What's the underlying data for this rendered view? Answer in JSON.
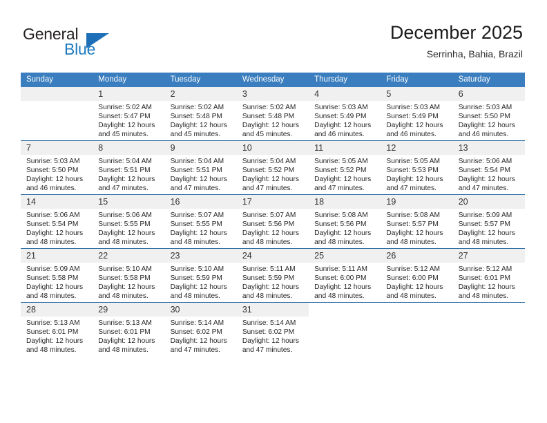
{
  "brand": {
    "name_part1": "General",
    "name_part2": "Blue",
    "triangle_color": "#1d6fb8"
  },
  "header": {
    "title": "December 2025",
    "location": "Serrinha, Bahia, Brazil"
  },
  "theme": {
    "header_blue": "#3a7ebf",
    "divider_blue": "#2e6da4",
    "daynum_band": "#f0f0f0"
  },
  "weekdays": [
    "Sunday",
    "Monday",
    "Tuesday",
    "Wednesday",
    "Thursday",
    "Friday",
    "Saturday"
  ],
  "weeks": [
    [
      {
        "day": "",
        "sunrise": "",
        "sunset": "",
        "daylight1": "",
        "daylight2": "",
        "empty": true
      },
      {
        "day": "1",
        "sunrise": "Sunrise: 5:02 AM",
        "sunset": "Sunset: 5:47 PM",
        "daylight1": "Daylight: 12 hours",
        "daylight2": "and 45 minutes."
      },
      {
        "day": "2",
        "sunrise": "Sunrise: 5:02 AM",
        "sunset": "Sunset: 5:48 PM",
        "daylight1": "Daylight: 12 hours",
        "daylight2": "and 45 minutes."
      },
      {
        "day": "3",
        "sunrise": "Sunrise: 5:02 AM",
        "sunset": "Sunset: 5:48 PM",
        "daylight1": "Daylight: 12 hours",
        "daylight2": "and 45 minutes."
      },
      {
        "day": "4",
        "sunrise": "Sunrise: 5:03 AM",
        "sunset": "Sunset: 5:49 PM",
        "daylight1": "Daylight: 12 hours",
        "daylight2": "and 46 minutes."
      },
      {
        "day": "5",
        "sunrise": "Sunrise: 5:03 AM",
        "sunset": "Sunset: 5:49 PM",
        "daylight1": "Daylight: 12 hours",
        "daylight2": "and 46 minutes."
      },
      {
        "day": "6",
        "sunrise": "Sunrise: 5:03 AM",
        "sunset": "Sunset: 5:50 PM",
        "daylight1": "Daylight: 12 hours",
        "daylight2": "and 46 minutes."
      }
    ],
    [
      {
        "day": "7",
        "sunrise": "Sunrise: 5:03 AM",
        "sunset": "Sunset: 5:50 PM",
        "daylight1": "Daylight: 12 hours",
        "daylight2": "and 46 minutes."
      },
      {
        "day": "8",
        "sunrise": "Sunrise: 5:04 AM",
        "sunset": "Sunset: 5:51 PM",
        "daylight1": "Daylight: 12 hours",
        "daylight2": "and 47 minutes."
      },
      {
        "day": "9",
        "sunrise": "Sunrise: 5:04 AM",
        "sunset": "Sunset: 5:51 PM",
        "daylight1": "Daylight: 12 hours",
        "daylight2": "and 47 minutes."
      },
      {
        "day": "10",
        "sunrise": "Sunrise: 5:04 AM",
        "sunset": "Sunset: 5:52 PM",
        "daylight1": "Daylight: 12 hours",
        "daylight2": "and 47 minutes."
      },
      {
        "day": "11",
        "sunrise": "Sunrise: 5:05 AM",
        "sunset": "Sunset: 5:52 PM",
        "daylight1": "Daylight: 12 hours",
        "daylight2": "and 47 minutes."
      },
      {
        "day": "12",
        "sunrise": "Sunrise: 5:05 AM",
        "sunset": "Sunset: 5:53 PM",
        "daylight1": "Daylight: 12 hours",
        "daylight2": "and 47 minutes."
      },
      {
        "day": "13",
        "sunrise": "Sunrise: 5:06 AM",
        "sunset": "Sunset: 5:54 PM",
        "daylight1": "Daylight: 12 hours",
        "daylight2": "and 47 minutes."
      }
    ],
    [
      {
        "day": "14",
        "sunrise": "Sunrise: 5:06 AM",
        "sunset": "Sunset: 5:54 PM",
        "daylight1": "Daylight: 12 hours",
        "daylight2": "and 48 minutes."
      },
      {
        "day": "15",
        "sunrise": "Sunrise: 5:06 AM",
        "sunset": "Sunset: 5:55 PM",
        "daylight1": "Daylight: 12 hours",
        "daylight2": "and 48 minutes."
      },
      {
        "day": "16",
        "sunrise": "Sunrise: 5:07 AM",
        "sunset": "Sunset: 5:55 PM",
        "daylight1": "Daylight: 12 hours",
        "daylight2": "and 48 minutes."
      },
      {
        "day": "17",
        "sunrise": "Sunrise: 5:07 AM",
        "sunset": "Sunset: 5:56 PM",
        "daylight1": "Daylight: 12 hours",
        "daylight2": "and 48 minutes."
      },
      {
        "day": "18",
        "sunrise": "Sunrise: 5:08 AM",
        "sunset": "Sunset: 5:56 PM",
        "daylight1": "Daylight: 12 hours",
        "daylight2": "and 48 minutes."
      },
      {
        "day": "19",
        "sunrise": "Sunrise: 5:08 AM",
        "sunset": "Sunset: 5:57 PM",
        "daylight1": "Daylight: 12 hours",
        "daylight2": "and 48 minutes."
      },
      {
        "day": "20",
        "sunrise": "Sunrise: 5:09 AM",
        "sunset": "Sunset: 5:57 PM",
        "daylight1": "Daylight: 12 hours",
        "daylight2": "and 48 minutes."
      }
    ],
    [
      {
        "day": "21",
        "sunrise": "Sunrise: 5:09 AM",
        "sunset": "Sunset: 5:58 PM",
        "daylight1": "Daylight: 12 hours",
        "daylight2": "and 48 minutes."
      },
      {
        "day": "22",
        "sunrise": "Sunrise: 5:10 AM",
        "sunset": "Sunset: 5:58 PM",
        "daylight1": "Daylight: 12 hours",
        "daylight2": "and 48 minutes."
      },
      {
        "day": "23",
        "sunrise": "Sunrise: 5:10 AM",
        "sunset": "Sunset: 5:59 PM",
        "daylight1": "Daylight: 12 hours",
        "daylight2": "and 48 minutes."
      },
      {
        "day": "24",
        "sunrise": "Sunrise: 5:11 AM",
        "sunset": "Sunset: 5:59 PM",
        "daylight1": "Daylight: 12 hours",
        "daylight2": "and 48 minutes."
      },
      {
        "day": "25",
        "sunrise": "Sunrise: 5:11 AM",
        "sunset": "Sunset: 6:00 PM",
        "daylight1": "Daylight: 12 hours",
        "daylight2": "and 48 minutes."
      },
      {
        "day": "26",
        "sunrise": "Sunrise: 5:12 AM",
        "sunset": "Sunset: 6:00 PM",
        "daylight1": "Daylight: 12 hours",
        "daylight2": "and 48 minutes."
      },
      {
        "day": "27",
        "sunrise": "Sunrise: 5:12 AM",
        "sunset": "Sunset: 6:01 PM",
        "daylight1": "Daylight: 12 hours",
        "daylight2": "and 48 minutes."
      }
    ],
    [
      {
        "day": "28",
        "sunrise": "Sunrise: 5:13 AM",
        "sunset": "Sunset: 6:01 PM",
        "daylight1": "Daylight: 12 hours",
        "daylight2": "and 48 minutes."
      },
      {
        "day": "29",
        "sunrise": "Sunrise: 5:13 AM",
        "sunset": "Sunset: 6:01 PM",
        "daylight1": "Daylight: 12 hours",
        "daylight2": "and 48 minutes."
      },
      {
        "day": "30",
        "sunrise": "Sunrise: 5:14 AM",
        "sunset": "Sunset: 6:02 PM",
        "daylight1": "Daylight: 12 hours",
        "daylight2": "and 47 minutes."
      },
      {
        "day": "31",
        "sunrise": "Sunrise: 5:14 AM",
        "sunset": "Sunset: 6:02 PM",
        "daylight1": "Daylight: 12 hours",
        "daylight2": "and 47 minutes."
      },
      {
        "day": "",
        "sunrise": "",
        "sunset": "",
        "daylight1": "",
        "daylight2": "",
        "blank": true
      },
      {
        "day": "",
        "sunrise": "",
        "sunset": "",
        "daylight1": "",
        "daylight2": "",
        "blank": true
      },
      {
        "day": "",
        "sunrise": "",
        "sunset": "",
        "daylight1": "",
        "daylight2": "",
        "blank": true
      }
    ]
  ]
}
